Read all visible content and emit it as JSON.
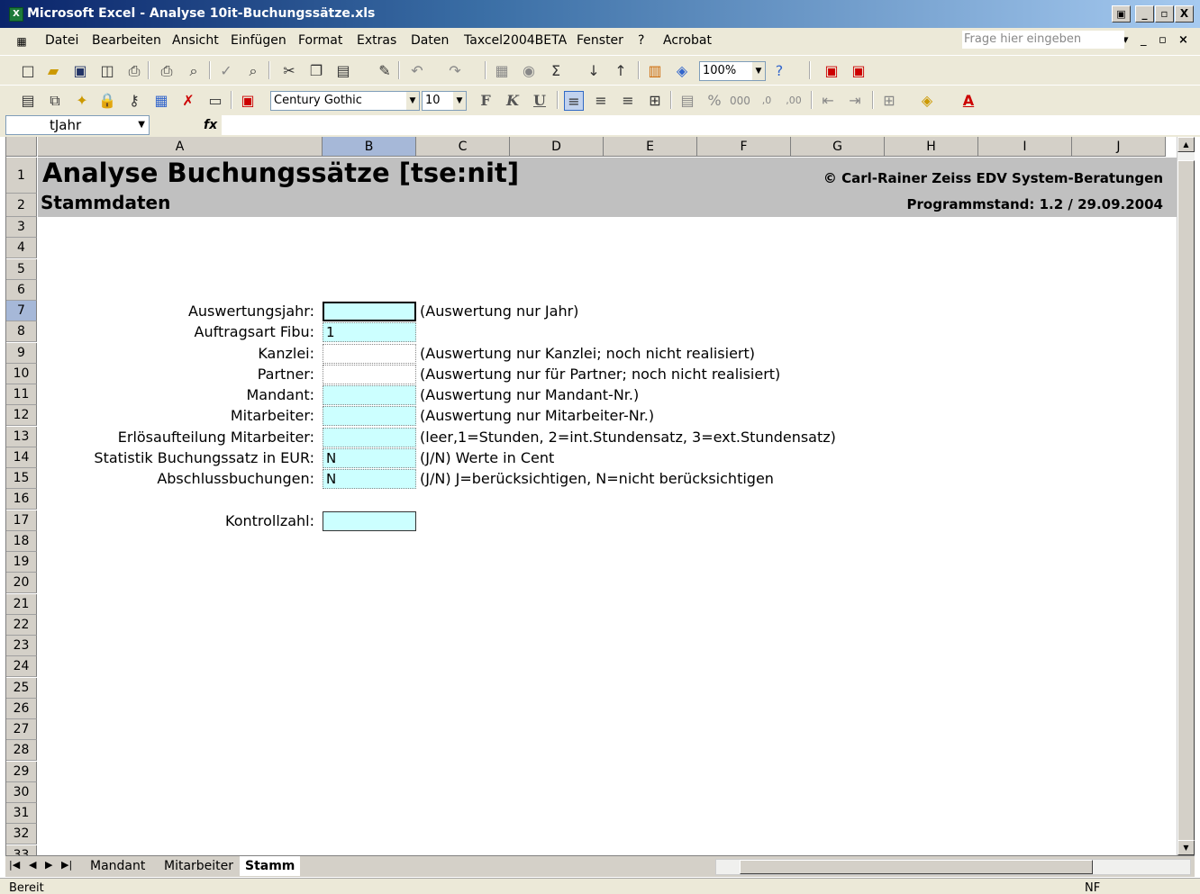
{
  "window": {
    "title": "Microsoft Excel - Analyse 10it-Buchungssätze.xls",
    "app_icon": "excel-icon",
    "controls": [
      "_",
      "▫",
      "X"
    ]
  },
  "menubar": {
    "items": [
      "Datei",
      "Bearbeiten",
      "Ansicht",
      "Einfügen",
      "Format",
      "Extras",
      "Daten",
      "Taxcel2004BETA",
      "Fenster",
      "?",
      "Acrobat"
    ],
    "help_placeholder": "Frage hier eingeben"
  },
  "toolbar_standard": {
    "zoom": "100%"
  },
  "toolbar_format": {
    "font": "Century Gothic",
    "size": "10",
    "bold": "F",
    "italic": "K",
    "underline": "U",
    "fill_color": "#ffff00",
    "font_color": "#ff0000"
  },
  "formula_bar": {
    "name_box": "tJahr",
    "fx": "fx",
    "content": ""
  },
  "columns": [
    "A",
    "B",
    "C",
    "D",
    "E",
    "F",
    "G",
    "H",
    "I",
    "J"
  ],
  "selected_column": "B",
  "rows": [
    "1",
    "2",
    "3",
    "4",
    "5",
    "6",
    "7",
    "8",
    "9",
    "10",
    "11",
    "12",
    "13",
    "14",
    "15",
    "16",
    "17",
    "18",
    "19",
    "20",
    "21",
    "22",
    "23",
    "24",
    "25",
    "26",
    "27",
    "28",
    "29",
    "30",
    "31",
    "32",
    "33"
  ],
  "selected_row": "7",
  "sheet": {
    "title": "Analyse Buchungssätze [tse:nit]",
    "subtitle": "Stammdaten",
    "copyright": "© Carl-Rainer Zeiss EDV System-Beratungen",
    "program_version": "Programmstand: 1.2 / 29.09.2004",
    "header_bg": "#c0c0c0",
    "input_bg": "#ccffff",
    "fields": [
      {
        "label": "Auswertungsjahr:",
        "value": "",
        "hint": "(Auswertung nur Jahr)"
      },
      {
        "label": "Auftragsart Fibu:",
        "value": "1",
        "hint": ""
      },
      {
        "label": "Kanzlei:",
        "value": "",
        "hint": "(Auswertung nur Kanzlei; noch nicht realisiert)"
      },
      {
        "label": "Partner:",
        "value": "",
        "hint": "(Auswertung nur für Partner; noch nicht realisiert)"
      },
      {
        "label": "Mandant:",
        "value": "",
        "hint": "(Auswertung nur Mandant-Nr.)"
      },
      {
        "label": "Mitarbeiter:",
        "value": "",
        "hint": "(Auswertung nur Mitarbeiter-Nr.)"
      },
      {
        "label": "Erlösaufteilung Mitarbeiter:",
        "value": "",
        "hint": "(leer,1=Stunden, 2=int.Stundensatz, 3=ext.Stundensatz)"
      },
      {
        "label": "Statistik Buchungssatz in EUR:",
        "value": "N",
        "hint": "(J/N) Werte in Cent"
      },
      {
        "label": "Abschlussbuchungen:",
        "value": "N",
        "hint": "(J/N) J=berücksichtigen, N=nicht berücksichtigen"
      }
    ],
    "control": {
      "label": "Kontrollzahl:",
      "value": ""
    }
  },
  "tabs": [
    "Mandant",
    "Mitarbeiter",
    "Stamm"
  ],
  "active_tab": "Stamm",
  "status": {
    "left": "Bereit",
    "right": "NF"
  }
}
